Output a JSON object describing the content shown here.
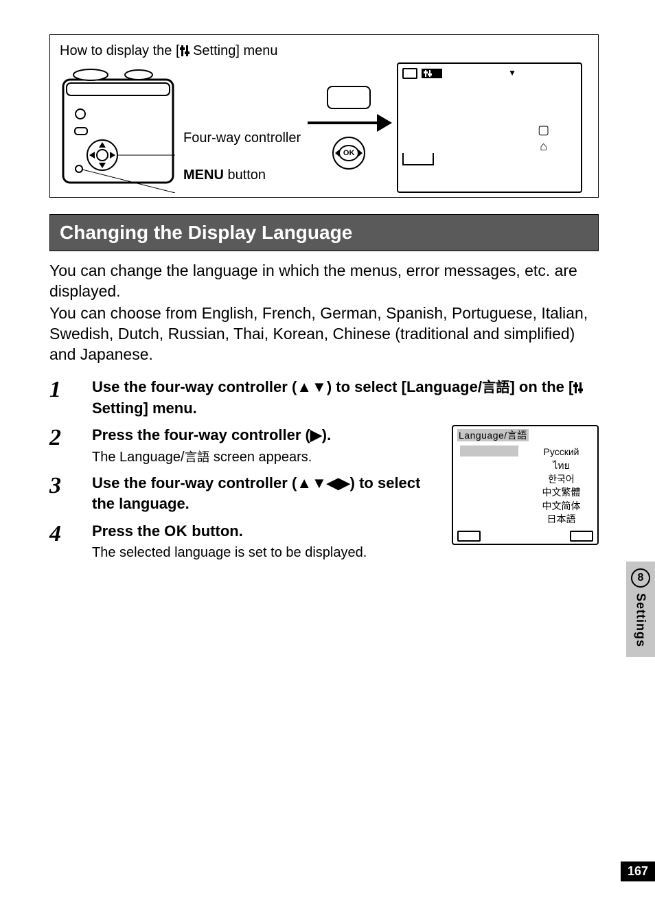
{
  "howbox": {
    "title_prefix": "How to display the [",
    "title_icon": "⛭",
    "title_suffix": " Setting] menu",
    "label_fourway": "Four-way controller",
    "label_menu_bold": "MENU",
    "label_menu_suffix": " button",
    "ok_label": "OK",
    "lcd_topbar": "⛭"
  },
  "heading": "Changing the Display Language",
  "intro1": "You can change the language in which the menus, error messages, etc. are displayed.",
  "intro2": "You can choose from English, French, German, Spanish, Portuguese, Italian, Swedish, Dutch, Russian, Thai, Korean, Chinese (traditional and simplified) and Japanese.",
  "steps": {
    "s1": {
      "num": "1",
      "title_a": "Use the four-way controller (▲▼) to select [Language/",
      "title_jp": "言語",
      "title_b": "] on the [",
      "title_icon": "⛭",
      "title_c": " Setting] menu."
    },
    "s2": {
      "num": "2",
      "title": "Press the four-way controller (▶).",
      "sub_a": "The Language/",
      "sub_jp": "言語",
      "sub_b": " screen appears."
    },
    "s3": {
      "num": "3",
      "title": "Use the four-way controller (▲▼◀▶) to select the language."
    },
    "s4": {
      "num": "4",
      "title_a": "Press the ",
      "title_ok": "OK",
      "title_b": " button.",
      "sub": "The selected language is set to be displayed."
    }
  },
  "lang_screen": {
    "header_a": "Language/",
    "header_jp": "言語",
    "right_col": [
      "Русский",
      "ไทย",
      "한국어",
      "中文繁體",
      "中文简体",
      "日本語"
    ]
  },
  "sidebar": {
    "chapter_num": "8",
    "chapter_name": "Settings"
  },
  "page_number": "167"
}
